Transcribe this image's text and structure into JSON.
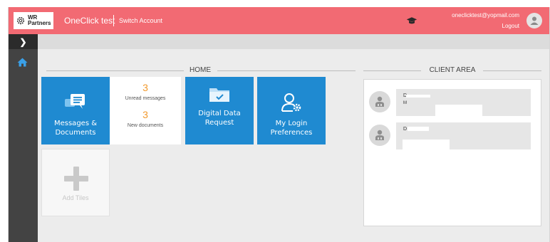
{
  "header": {
    "logo_text_line1": "WR",
    "logo_text_line2": "Partners",
    "app_name": "OneClick test",
    "switch_account": "Switch Account",
    "user_email": "oneclicktest@yopmail.com",
    "logout": "Logout"
  },
  "home": {
    "section_title": "HOME",
    "tiles": {
      "messages": "Messages & Documents",
      "unread_count": "3",
      "unread_label": "Unread messages",
      "new_docs_count": "3",
      "new_docs_label": "New documents",
      "digital_data": "Digital Data Request",
      "login_prefs": "My Login Preferences",
      "add_tiles": "Add Tiles"
    }
  },
  "client_area": {
    "section_title": "CLIENT AREA",
    "contacts": [
      {
        "name": "D",
        "role": "M"
      },
      {
        "name": "D",
        "role": ""
      }
    ]
  },
  "colors": {
    "header_bg": "#f26a73",
    "tile_blue": "#1f8ad1",
    "count_orange": "#f29a2e",
    "sidebar": "#434343"
  }
}
